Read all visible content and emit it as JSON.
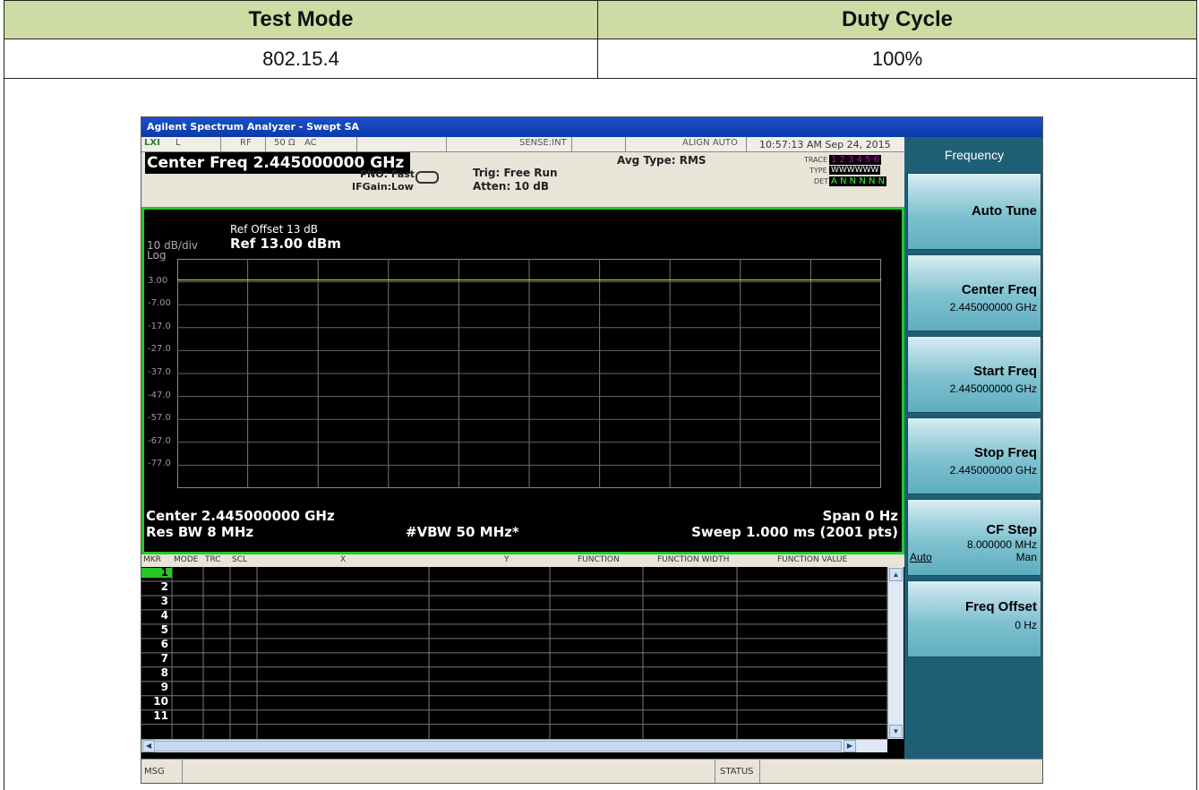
{
  "table": {
    "col1_header": "Test Mode",
    "col2_header": "Duty Cycle",
    "col1_value": "802.15.4",
    "col2_value": "100%"
  },
  "analyzer": {
    "window_title": "Agilent Spectrum Analyzer - Swept SA",
    "top_strip": {
      "lxi": "LXI",
      "l": "L",
      "rf": "RF",
      "imp": "50 Ω",
      "ac": "AC",
      "sense": "SENSE:INT",
      "align": "ALIGN AUTO",
      "datetime": "10:57:13 AM Sep 24, 2015"
    },
    "center_freq_banner": "Center Freq 2.445000000 GHz",
    "pno": "PNO: Fast",
    "ifgain": "IFGain:Low",
    "trig": "Trig: Free Run",
    "atten": "Atten: 10 dB",
    "avg_type": "Avg Type: RMS",
    "trace_label": "TRACE",
    "trace_values": "1 2 3 4 5 6",
    "type_label": "TYPE",
    "type_values": "WWWWWW",
    "det_label": "DET",
    "det_values": "A N N N N N",
    "ref_offset": "Ref Offset 13 dB",
    "scale": "10 dB/div",
    "ref_level": "Ref 13.00 dBm",
    "log": "Log",
    "y_ticks": [
      "3.00",
      "-7.00",
      "-17.0",
      "-27.0",
      "-37.0",
      "-47.0",
      "-57.0",
      "-67.0",
      "-77.0"
    ],
    "trace_level_db": 3.0,
    "center_label": "Center 2.445000000 GHz",
    "span_label": "Span 0 Hz",
    "res_bw": "Res BW 8 MHz",
    "vbw": "#VBW 50 MHz*",
    "sweep": "Sweep  1.000 ms (2001 pts)",
    "marker_table": {
      "columns": [
        "MKR",
        "MODE",
        "TRC",
        "SCL",
        "X",
        "Y",
        "FUNCTION",
        "FUNCTION WIDTH",
        "FUNCTION VALUE"
      ],
      "rows": [
        "1",
        "2",
        "3",
        "4",
        "5",
        "6",
        "7",
        "8",
        "9",
        "10",
        "11"
      ]
    },
    "msg_label": "MSG",
    "status_label": "STATUS",
    "softkeys": {
      "menu_title": "Frequency",
      "auto_tune": "Auto Tune",
      "center_freq": "Center Freq",
      "center_freq_val": "2.445000000 GHz",
      "start_freq": "Start Freq",
      "start_freq_val": "2.445000000 GHz",
      "stop_freq": "Stop Freq",
      "stop_freq_val": "2.445000000 GHz",
      "cf_step": "CF Step",
      "cf_step_val": "8.000000 MHz",
      "cf_step_auto": "Auto",
      "cf_step_man": "Man",
      "freq_offset": "Freq Offset",
      "freq_offset_val": "0 Hz"
    },
    "colors": {
      "screen_border": "#25c825",
      "trace": "#e6e64a",
      "softkey_bg": "#1f5f76",
      "header_green": "#cddba4"
    }
  }
}
